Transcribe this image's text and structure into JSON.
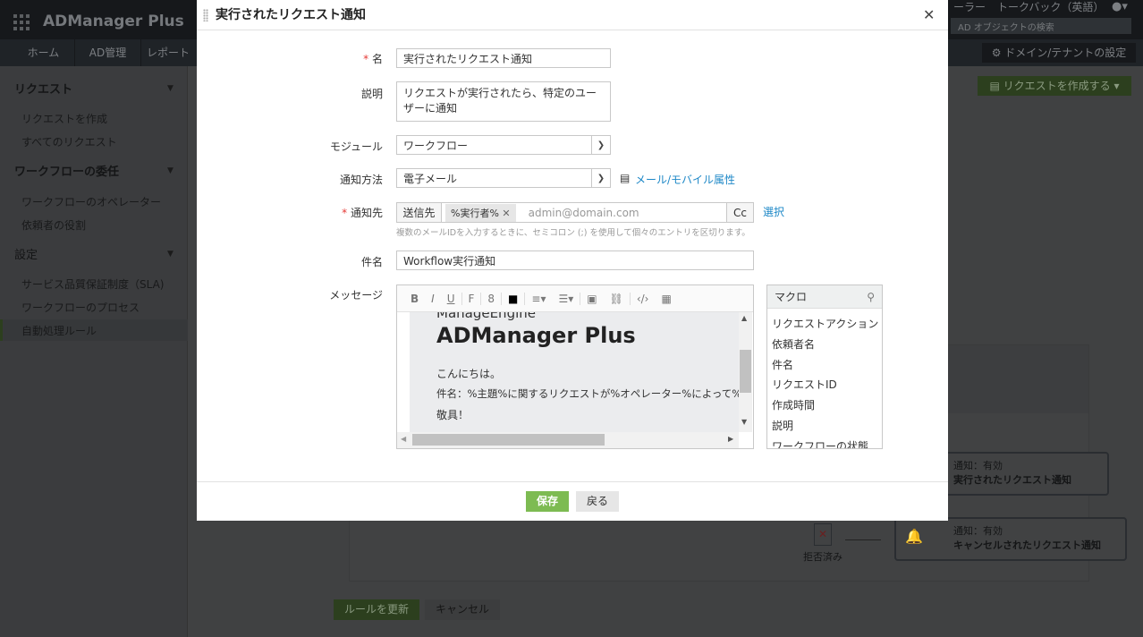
{
  "app": {
    "logo": "ADManager Plus",
    "nav_tabs": [
      "ホーム",
      "AD管理",
      "レポート"
    ],
    "top_links": [
      "ーラー",
      "トークバック（英語）"
    ],
    "search_placeholder": "AD オブジェクトの検索",
    "domain_settings": "ドメイン/テナントの設定",
    "create_request": "リクエストを作成する"
  },
  "sidebar": {
    "sections": [
      {
        "title": "リクエスト",
        "items": [
          "リクエストを作成",
          "すべてのリクエスト"
        ]
      },
      {
        "title": "ワークフローの委任",
        "items": [
          "ワークフローのオペレーター",
          "依頼者の役割"
        ]
      },
      {
        "title": "設定",
        "items": [
          "サービス品質保証制度（SLA)",
          "ワークフローのプロセス",
          "自動処理ルール"
        ]
      }
    ]
  },
  "background": {
    "notify1": {
      "status": "通知：有効",
      "name": "実行されたリクエスト通知"
    },
    "notify2": {
      "status": "通知：有効",
      "name": "キャンセルされたリクエスト通知"
    },
    "rejected": "拒否済み",
    "update_rule": "ルールを更新",
    "cancel": "キャンセル"
  },
  "modal": {
    "title": "実行されたリクエスト通知",
    "fields": {
      "name": {
        "label": "名",
        "value": "実行されたリクエスト通知"
      },
      "description": {
        "label": "説明",
        "value": "リクエストが実行されたら、特定のユーザーに通知"
      },
      "module": {
        "label": "モジュール",
        "value": "ワークフロー"
      },
      "method": {
        "label": "通知方法",
        "value": "電子メール",
        "link": "メール/モバイル属性"
      },
      "recipients": {
        "label": "通知先",
        "to_label": "送信先",
        "chip": "%実行者%",
        "placeholder": "admin@domain.com",
        "cc": "Cc",
        "select": "選択",
        "hint": "複数のメールIDを入力するときに、セミコロン (;) を使用して個々のエントリを区切ります。"
      },
      "subject": {
        "label": "件名",
        "value": "Workflow実行通知"
      },
      "message": {
        "label": "メッセージ"
      }
    },
    "editor": {
      "toolbar": [
        "B",
        "I",
        "U",
        "F",
        "8"
      ],
      "brand_top": "ManageEngine",
      "brand": "ADManager Plus",
      "greeting": "こんにちは。",
      "body": "件名：%主題%に関するリクエストが%オペレーター%によって%'",
      "closing": "敬具！"
    },
    "macros": {
      "title": "マクロ",
      "items": [
        "リクエストアクション",
        "依頼者名",
        "件名",
        "リクエストID",
        "作成時間",
        "説明",
        "ワークフローの状態"
      ]
    },
    "save": "保存",
    "back": "戻る"
  },
  "colors": {
    "accent": "#7dbb52",
    "link": "#1e88c7",
    "required": "#e53935"
  }
}
